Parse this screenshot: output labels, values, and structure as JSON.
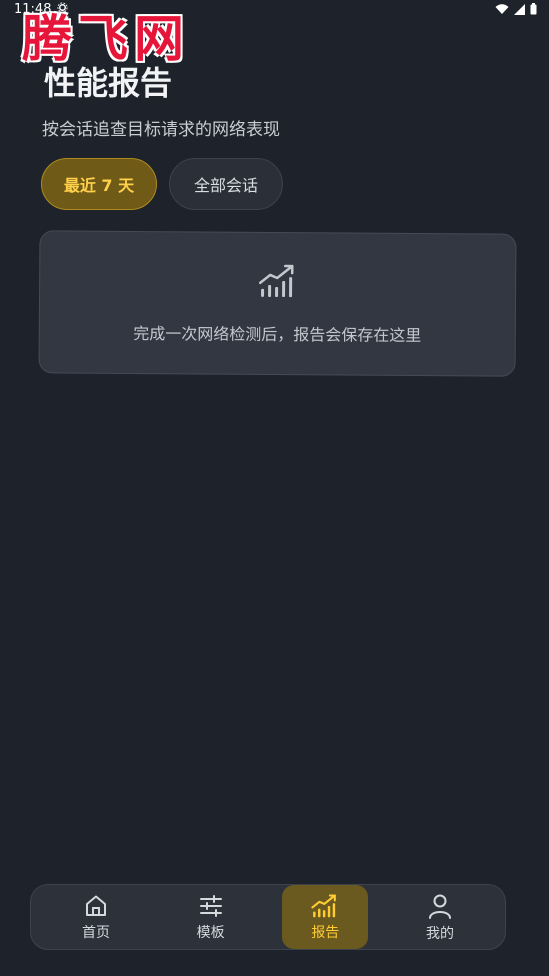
{
  "status_bar": {
    "time": "11:48"
  },
  "watermark": {
    "text": "腾飞网"
  },
  "header": {
    "title": "性能报告",
    "subtitle": "按会话追查目标请求的网络表现"
  },
  "filters": {
    "active_label": "最近 7 天",
    "inactive_label": "全部会话"
  },
  "empty_state": {
    "icon": "signal-chart-icon",
    "message": "完成一次网络检测后，报告会保存在这里"
  },
  "nav": {
    "items": [
      {
        "label": "首页",
        "icon": "home-icon"
      },
      {
        "label": "模板",
        "icon": "sliders-icon"
      },
      {
        "label": "报告",
        "icon": "chart-icon",
        "active": true
      },
      {
        "label": "我的",
        "icon": "user-icon"
      }
    ]
  },
  "colors": {
    "background": "#1e232b",
    "accent": "#ffcc33",
    "watermark": "#e6163a"
  }
}
